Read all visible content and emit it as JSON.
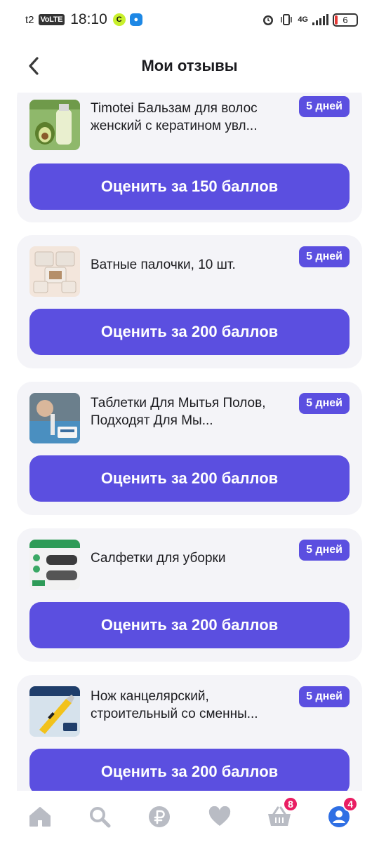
{
  "statusbar": {
    "carrier": "t2",
    "volte": "VoLTE",
    "time": "18:10",
    "network": "4G",
    "battery": "6"
  },
  "header": {
    "title": "Мои отзывы"
  },
  "reviews": [
    {
      "name": "Timotei Бальзам для волос женский с кератином увл...",
      "days": "5 дней",
      "button": "Оценить за 150 баллов"
    },
    {
      "name": "Ватные палочки, 10 шт.",
      "days": "5 дней",
      "button": "Оценить за 200 баллов"
    },
    {
      "name": "Таблетки Для Мытья Полов, Подходят Для Мы...",
      "days": "5 дней",
      "button": "Оценить за 200 баллов"
    },
    {
      "name": "Салфетки для уборки",
      "days": "5 дней",
      "button": "Оценить за 200 баллов"
    },
    {
      "name": "Нож канцелярский, строительный со сменны...",
      "days": "5 дней",
      "button": "Оценить за 200 баллов"
    }
  ],
  "bottomnav": {
    "cart_badge": "8",
    "profile_badge": "4"
  },
  "colors": {
    "accent": "#5b4fe0",
    "card_bg": "#f4f4f8",
    "badge": "#e91e63"
  }
}
